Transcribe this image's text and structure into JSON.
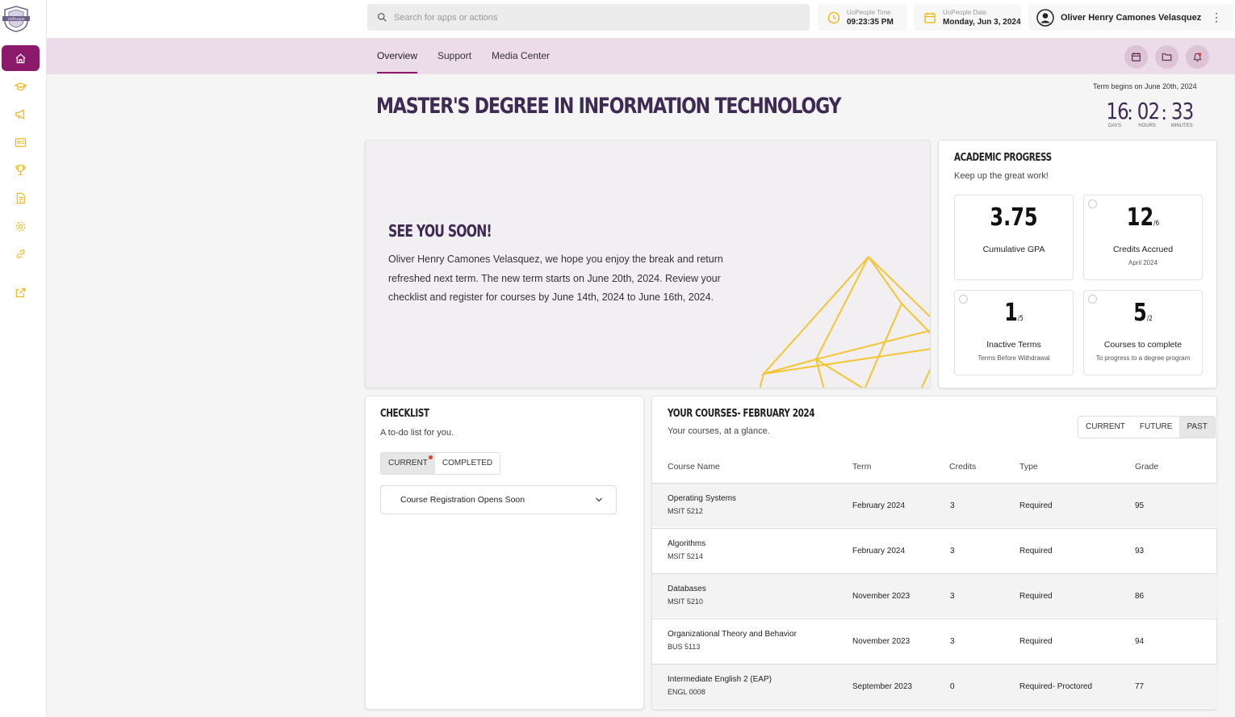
{
  "sidebar": {
    "logo_text": "UoPeople",
    "items": [
      {
        "icon": "home-icon",
        "active": true
      },
      {
        "icon": "graduation-cap-icon"
      },
      {
        "icon": "megaphone-icon"
      },
      {
        "icon": "id-card-icon"
      },
      {
        "icon": "trophy-icon"
      },
      {
        "icon": "document-icon"
      },
      {
        "icon": "settings-icon"
      },
      {
        "icon": "link-icon"
      },
      {
        "icon": "external-link-icon"
      }
    ]
  },
  "topbar": {
    "search_placeholder": "Search for apps or actions",
    "time_label": "UoPeople Time",
    "time_value": "09:23:35 PM",
    "date_label": "UoPeople Date",
    "date_value": "Monday, Jun 3, 2024",
    "user_name": "Oliver Henry Camones Velasquez"
  },
  "subnav": {
    "tabs": [
      "Overview",
      "Support",
      "Media Center"
    ]
  },
  "header": {
    "title": "MASTER'S DEGREE IN INFORMATION TECHNOLOGY",
    "term_note": "Term begins on June 20th, 2024",
    "countdown": {
      "days": "16",
      "hours": "02",
      "minutes": "33",
      "days_label": "DAYS",
      "hours_label": "HOURS",
      "minutes_label": "MINUTES"
    }
  },
  "hero": {
    "heading": "SEE YOU SOON!",
    "body": "Oliver Henry Camones Velasquez, we hope you enjoy the break and return refreshed next term. The new term starts on June 20th, 2024. Review your checklist and register for courses by June 14th, 2024 to June 16th, 2024."
  },
  "progress": {
    "heading": "ACADEMIC PROGRESS",
    "sub": "Keep up the great work!",
    "stats": [
      {
        "value": "3.75",
        "denom": "",
        "label": "Cumulative GPA",
        "sub": ""
      },
      {
        "value": "12",
        "denom": "/6",
        "label": "Credits Accrued",
        "sub": "April 2024"
      },
      {
        "value": "1",
        "denom": "/5",
        "label": "Inactive Terms",
        "sub": "Terms Before Withdrawal"
      },
      {
        "value": "5",
        "denom": "/2",
        "label": "Courses to complete",
        "sub": "To progress to a degree program"
      }
    ]
  },
  "checklist": {
    "heading": "CHECKLIST",
    "sub": "A to-do list for you.",
    "tabs": [
      "CURRENT",
      "COMPLETED"
    ],
    "item": "Course Registration Opens Soon"
  },
  "courses": {
    "heading": "YOUR COURSES- FEBRUARY 2024",
    "sub": "Your courses, at a glance.",
    "filters": [
      "CURRENT",
      "FUTURE",
      "PAST"
    ],
    "columns": [
      "Course Name",
      "Term",
      "Credits",
      "Type",
      "Grade"
    ],
    "rows": [
      {
        "name": "Operating Systems",
        "code": "MSIT 5212",
        "term": "February 2024",
        "credits": "3",
        "type": "Required",
        "grade": "95"
      },
      {
        "name": "Algorithms",
        "code": "MSIT 5214",
        "term": "February 2024",
        "credits": "3",
        "type": "Required",
        "grade": "93"
      },
      {
        "name": "Databases",
        "code": "MSIT 5210",
        "term": "November 2023",
        "credits": "3",
        "type": "Required",
        "grade": "86"
      },
      {
        "name": "Organizational Theory and Behavior",
        "code": "BUS 5113",
        "term": "November 2023",
        "credits": "3",
        "type": "Required",
        "grade": "94"
      },
      {
        "name": "Intermediate English 2 (EAP)",
        "code": "ENGL 0008",
        "term": "September 2023",
        "credits": "0",
        "type": "Required- Proctored",
        "grade": "77"
      }
    ]
  },
  "colors": {
    "accent": "#8b1a6b",
    "icon_gold": "#f0b400",
    "title_purple": "#3e2b54",
    "subnav_bg": "#ecdbe8"
  }
}
